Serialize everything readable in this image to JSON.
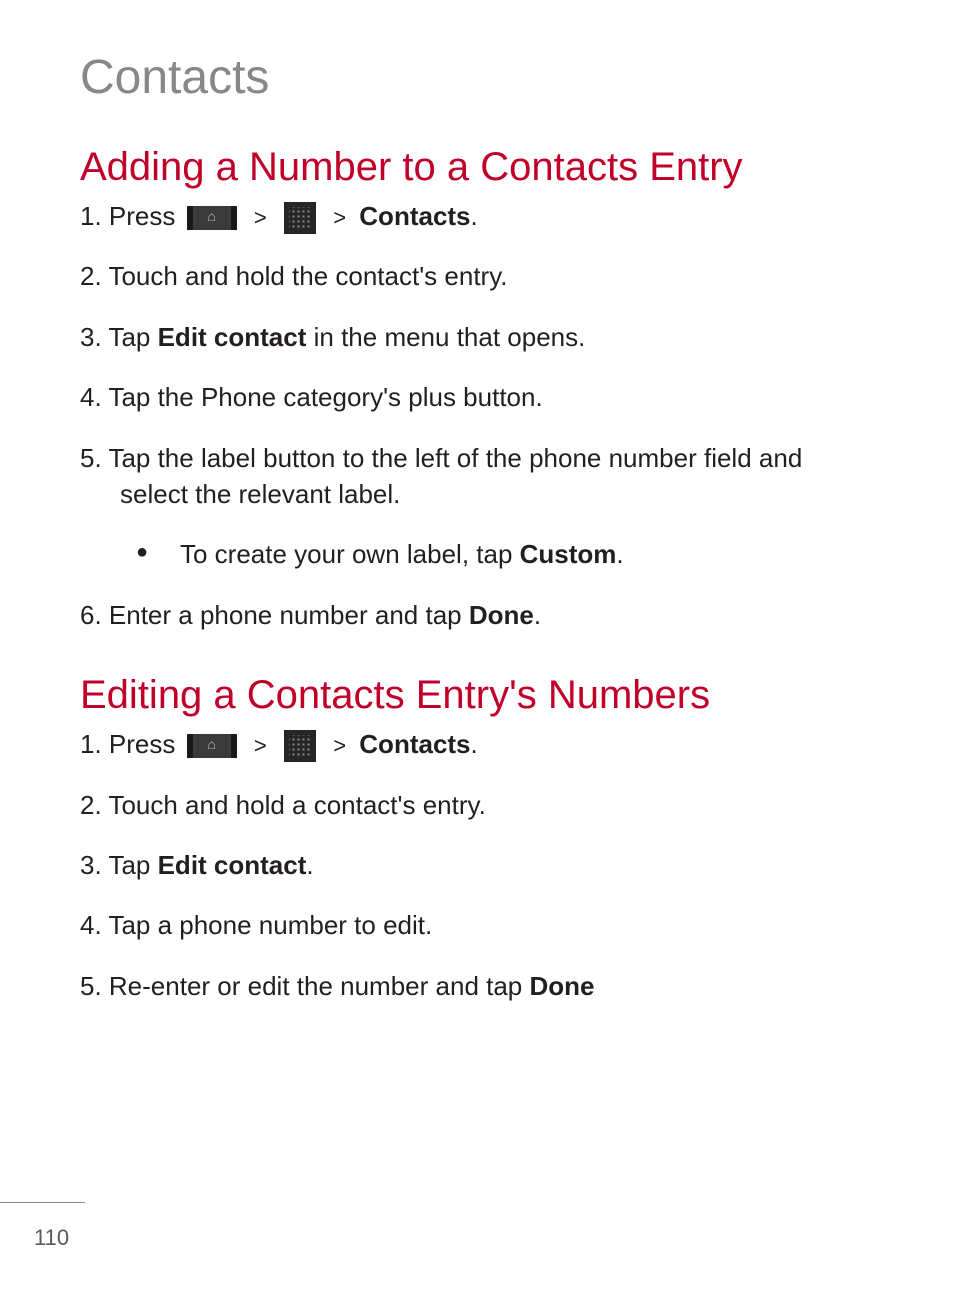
{
  "page": {
    "title": "Contacts",
    "number": "110"
  },
  "section1": {
    "heading": "Adding a Number to a Contacts Entry",
    "step1_a": "1.",
    "step1_b": "Press",
    "step1_sep": ">",
    "step1_contacts": "Contacts",
    "step1_dot": ".",
    "step2": "2. Touch and hold the contact's entry.",
    "step3_a": "3. Tap ",
    "step3_bold": "Edit contact",
    "step3_b": " in the menu that opens.",
    "step4": "4. Tap the Phone category's plus button.",
    "step5": "5. Tap the label button to the left of the phone number field and select the relevant label.",
    "bullet_a": "To create your own label, tap ",
    "bullet_bold": "Custom",
    "bullet_b": ".",
    "step6_a": "6. Enter a phone number and tap ",
    "step6_bold": "Done",
    "step6_b": "."
  },
  "section2": {
    "heading": "Editing a Contacts Entry's Numbers",
    "step1_a": "1.",
    "step1_b": "Press",
    "step1_sep": ">",
    "step1_contacts": "Contacts",
    "step1_dot": ".",
    "step2": "2. Touch and hold a contact's entry.",
    "step3_a": "3. Tap ",
    "step3_bold": "Edit contact",
    "step3_b": ".",
    "step4": "4. Tap a phone number to edit.",
    "step5_a": "5. Re-enter or edit the number and tap ",
    "step5_bold": "Done"
  }
}
